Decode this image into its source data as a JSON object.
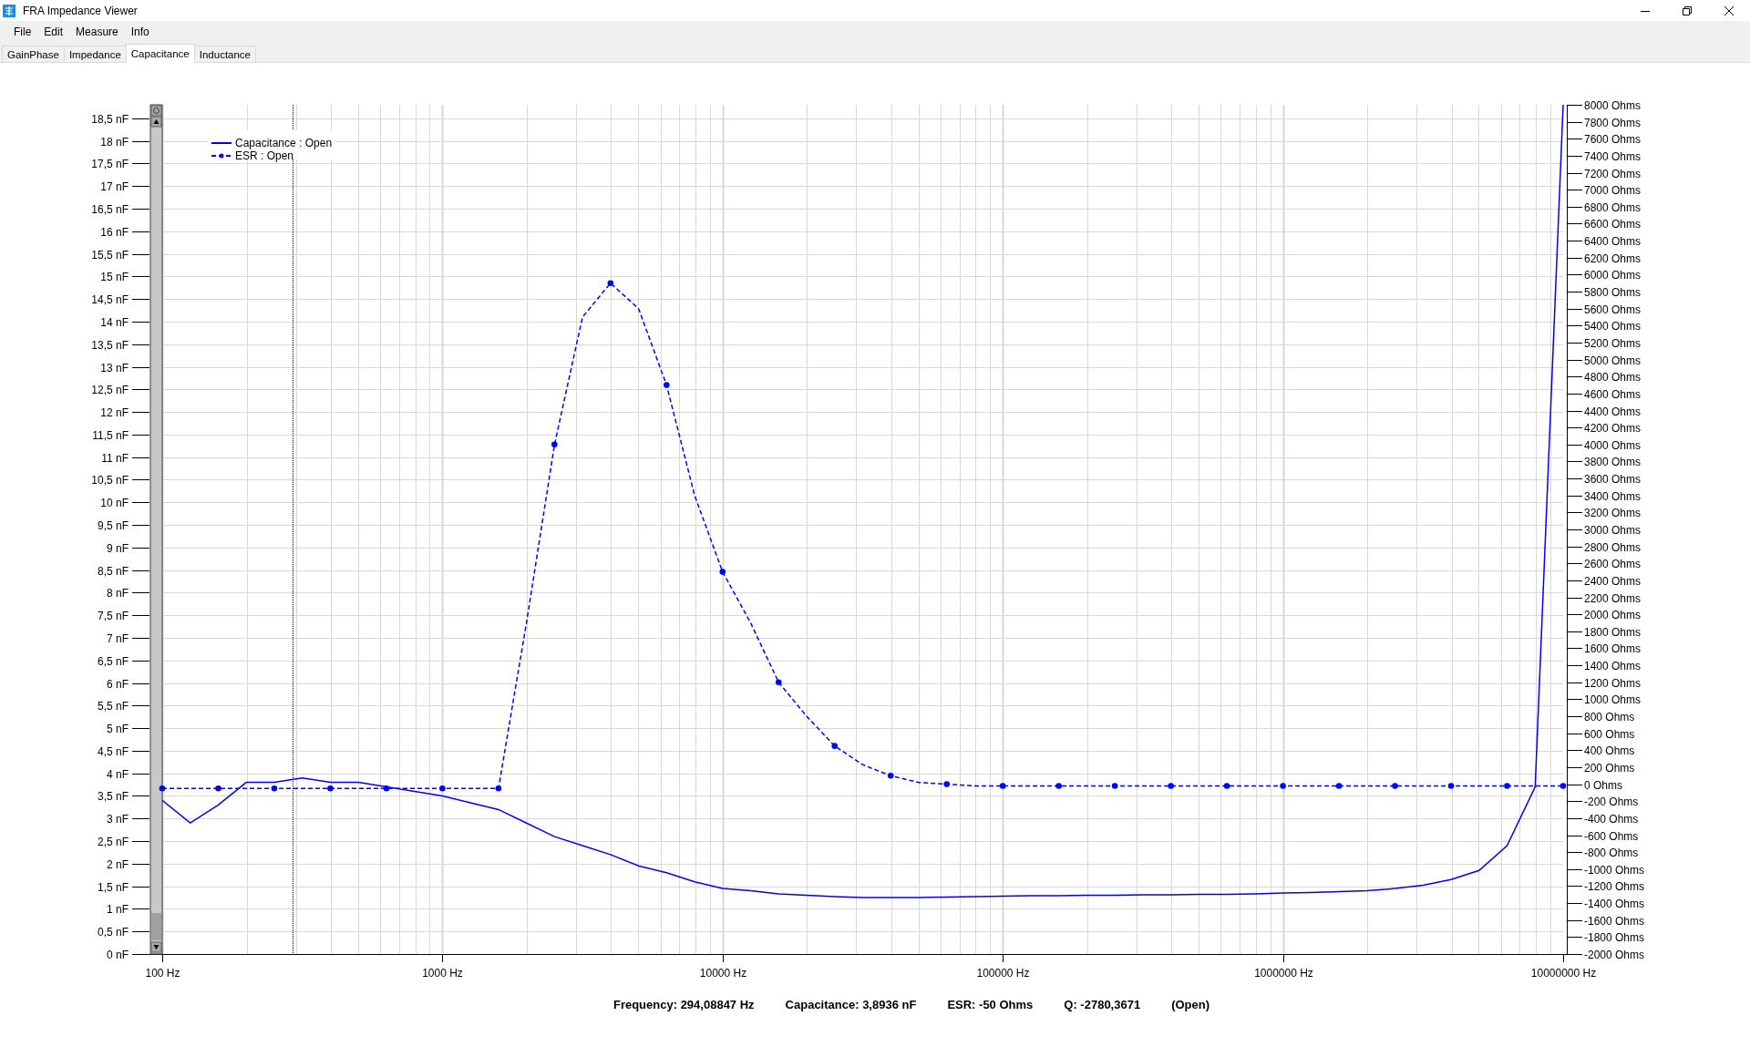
{
  "window": {
    "title": "FRA Impedance Viewer"
  },
  "menu": [
    "File",
    "Edit",
    "Measure",
    "Info"
  ],
  "tabs": [
    {
      "label": "GainPhase",
      "selected": false
    },
    {
      "label": "Impedance",
      "selected": false
    },
    {
      "label": "Capacitance",
      "selected": true
    },
    {
      "label": "Inductance",
      "selected": false
    }
  ],
  "chart": {
    "chart_data": {
      "type": "line",
      "grid": true,
      "legend": "top-left",
      "categories": [
        "100 Hz",
        null,
        null,
        null,
        null,
        null,
        null,
        null,
        null,
        null,
        "1000 Hz",
        null,
        null,
        null,
        null,
        null,
        null,
        null,
        null,
        null,
        "10000 Hz",
        null,
        null,
        null,
        null,
        null,
        null,
        null,
        null,
        null,
        "100000 Hz",
        null,
        null,
        null,
        null,
        null,
        null,
        null,
        null,
        null,
        "1000000 Hz",
        null,
        null,
        null,
        null,
        null,
        null,
        null,
        null,
        null,
        "10000000 Hz"
      ],
      "series": [
        {
          "name": "Capacitance : Open",
          "color": "#0000ff",
          "line_style": "solid",
          "values": [
            3.4,
            2.9,
            3.3,
            3.8,
            3.8,
            3.9,
            3.8,
            3.8,
            3.7,
            3.6,
            3.5,
            3.35,
            3.2,
            2.9,
            2.6,
            2.4,
            2.2,
            1.95,
            1.8,
            1.6,
            1.45,
            1.4,
            1.33,
            1.3,
            1.27,
            1.25,
            1.25,
            1.25,
            1.26,
            1.27,
            1.28,
            1.29,
            1.29,
            1.3,
            1.3,
            1.31,
            1.31,
            1.32,
            1.32,
            1.33,
            1.35,
            1.36,
            1.38,
            1.4,
            1.45,
            1.52,
            1.65,
            1.85,
            2.4,
            3.7,
            18.8
          ]
        },
        {
          "name": "ESR : Open",
          "color": "#0000ff",
          "line_style": "dashed",
          "axis": "y2",
          "values": [
            -50,
            -50,
            -50,
            -50,
            -50,
            -50,
            -50,
            -50,
            -50,
            -50,
            -50,
            -50,
            -50,
            1900,
            4000,
            5500,
            5900,
            5600,
            4700,
            3400,
            2500,
            1900,
            1200,
            800,
            450,
            230,
            100,
            20,
            0,
            -20,
            -20,
            -20,
            -20,
            -20,
            -20,
            -20,
            -20,
            -20,
            -20,
            -20,
            -20,
            -20,
            -20,
            -20,
            -20,
            -20,
            -20,
            -20,
            -20,
            -20,
            -20
          ]
        }
      ],
      "ylim": [
        0,
        18.8
      ],
      "y2lim": [
        -2000,
        8000
      ],
      "yticks": [
        {
          "value": 0,
          "label": "0 nF"
        },
        {
          "value": 0.5,
          "label": "0,5 nF"
        },
        {
          "value": 1,
          "label": "1 nF"
        },
        {
          "value": 1.5,
          "label": "1,5 nF"
        },
        {
          "value": 2,
          "label": "2 nF"
        },
        {
          "value": 2.5,
          "label": "2,5 nF"
        },
        {
          "value": 3,
          "label": "3 nF"
        },
        {
          "value": 3.5,
          "label": "3,5 nF"
        },
        {
          "value": 4,
          "label": "4 nF"
        },
        {
          "value": 4.5,
          "label": "4,5 nF"
        },
        {
          "value": 5,
          "label": "5 nF"
        },
        {
          "value": 5.5,
          "label": "5,5 nF"
        },
        {
          "value": 6,
          "label": "6 nF"
        },
        {
          "value": 6.5,
          "label": "6,5 nF"
        },
        {
          "value": 7,
          "label": "7 nF"
        },
        {
          "value": 7.5,
          "label": "7,5 nF"
        },
        {
          "value": 8,
          "label": "8 nF"
        },
        {
          "value": 8.5,
          "label": "8,5 nF"
        },
        {
          "value": 9,
          "label": "9 nF"
        },
        {
          "value": 9.5,
          "label": "9,5 nF"
        },
        {
          "value": 10,
          "label": "10 nF"
        },
        {
          "value": 10.5,
          "label": "10,5 nF"
        },
        {
          "value": 11,
          "label": "11 nF"
        },
        {
          "value": 11.5,
          "label": "11,5 nF"
        },
        {
          "value": 12,
          "label": "12 nF"
        },
        {
          "value": 12.5,
          "label": "12,5 nF"
        },
        {
          "value": 13,
          "label": "13 nF"
        },
        {
          "value": 13.5,
          "label": "13,5 nF"
        },
        {
          "value": 14,
          "label": "14 nF"
        },
        {
          "value": 14.5,
          "label": "14,5 nF"
        },
        {
          "value": 15,
          "label": "15 nF"
        },
        {
          "value": 15.5,
          "label": "15,5 nF"
        },
        {
          "value": 16,
          "label": "16 nF"
        },
        {
          "value": 16.5,
          "label": "16,5 nF"
        },
        {
          "value": 17,
          "label": "17 nF"
        },
        {
          "value": 17.5,
          "label": "17,5 nF"
        },
        {
          "value": 18,
          "label": "18 nF"
        },
        {
          "value": 18.5,
          "label": "18,5 nF"
        }
      ],
      "y2ticks": [
        {
          "value": 8000,
          "label": "8000 Ohms"
        },
        {
          "value": 7800,
          "label": "7800 Ohms"
        },
        {
          "value": 7600,
          "label": "7600 Ohms"
        },
        {
          "value": 7400,
          "label": "7400 Ohms"
        },
        {
          "value": 7200,
          "label": "7200 Ohms"
        },
        {
          "value": 7000,
          "label": "7000 Ohms"
        },
        {
          "value": 6800,
          "label": "6800 Ohms"
        },
        {
          "value": 6600,
          "label": "6600 Ohms"
        },
        {
          "value": 6400,
          "label": "6400 Ohms"
        },
        {
          "value": 6200,
          "label": "6200 Ohms"
        },
        {
          "value": 6000,
          "label": "6000 Ohms"
        },
        {
          "value": 5800,
          "label": "5800 Ohms"
        },
        {
          "value": 5600,
          "label": "5600 Ohms"
        },
        {
          "value": 5400,
          "label": "5400 Ohms"
        },
        {
          "value": 5200,
          "label": "5200 Ohms"
        },
        {
          "value": 5000,
          "label": "5000 Ohms"
        },
        {
          "value": 4800,
          "label": "4800 Ohms"
        },
        {
          "value": 4600,
          "label": "4600 Ohms"
        },
        {
          "value": 4400,
          "label": "4400 Ohms"
        },
        {
          "value": 4200,
          "label": "4200 Ohms"
        },
        {
          "value": 4000,
          "label": "4000 Ohms"
        },
        {
          "value": 3800,
          "label": "3800 Ohms"
        },
        {
          "value": 3600,
          "label": "3600 Ohms"
        },
        {
          "value": 3400,
          "label": "3400 Ohms"
        },
        {
          "value": 3200,
          "label": "3200 Ohms"
        },
        {
          "value": 3000,
          "label": "3000 Ohms"
        },
        {
          "value": 2800,
          "label": "2800 Ohms"
        },
        {
          "value": 2600,
          "label": "2600 Ohms"
        },
        {
          "value": 2400,
          "label": "2400 Ohms"
        },
        {
          "value": 2200,
          "label": "2200 Ohms"
        },
        {
          "value": 2000,
          "label": "2000 Ohms"
        },
        {
          "value": 1800,
          "label": "1800 Ohms"
        },
        {
          "value": 1600,
          "label": "1600 Ohms"
        },
        {
          "value": 1400,
          "label": "1400 Ohms"
        },
        {
          "value": 1200,
          "label": "1200 Ohms"
        },
        {
          "value": 1000,
          "label": "1000 Ohms"
        },
        {
          "value": 800,
          "label": "800 Ohms"
        },
        {
          "value": 600,
          "label": "600 Ohms"
        },
        {
          "value": 400,
          "label": "400 Ohms"
        },
        {
          "value": 200,
          "label": "200 Ohms"
        },
        {
          "value": 0,
          "label": "0 Ohms"
        },
        {
          "value": -200,
          "label": "-200 Ohms"
        },
        {
          "value": -400,
          "label": "-400 Ohms"
        },
        {
          "value": -600,
          "label": "-600 Ohms"
        },
        {
          "value": -800,
          "label": "-800 Ohms"
        },
        {
          "value": -1000,
          "label": "-1000 Ohms"
        },
        {
          "value": -1200,
          "label": "-1200 Ohms"
        },
        {
          "value": -1400,
          "label": "-1400 Ohms"
        },
        {
          "value": -1600,
          "label": "-1600 Ohms"
        },
        {
          "value": -1800,
          "label": "-1800 Ohms"
        },
        {
          "value": -2000,
          "label": "-2000 Ohms"
        }
      ]
    }
  },
  "readout": [
    "Frequency: 294,08847 Hz",
    "Capacitance: 3,8936 nF",
    "ESR: -50 Ohms",
    "Q: -2780,3671",
    "(Open)"
  ]
}
